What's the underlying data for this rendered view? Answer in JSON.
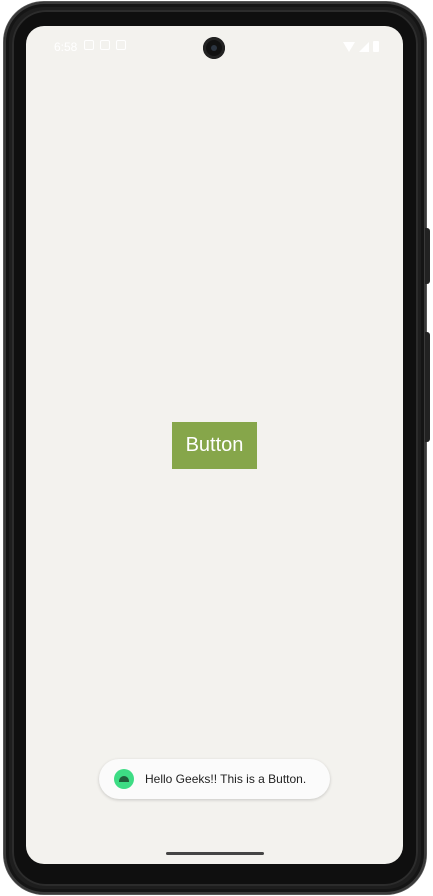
{
  "status_bar": {
    "time": "6:58"
  },
  "main": {
    "button_label": "Button"
  },
  "toast": {
    "icon": "android-icon",
    "message": "Hello Geeks!! This is a Button."
  },
  "colors": {
    "screen_background": "#f3f2ee",
    "button_background": "#86a64a",
    "button_text": "#ffffff",
    "toast_icon": "#3ddc84"
  }
}
